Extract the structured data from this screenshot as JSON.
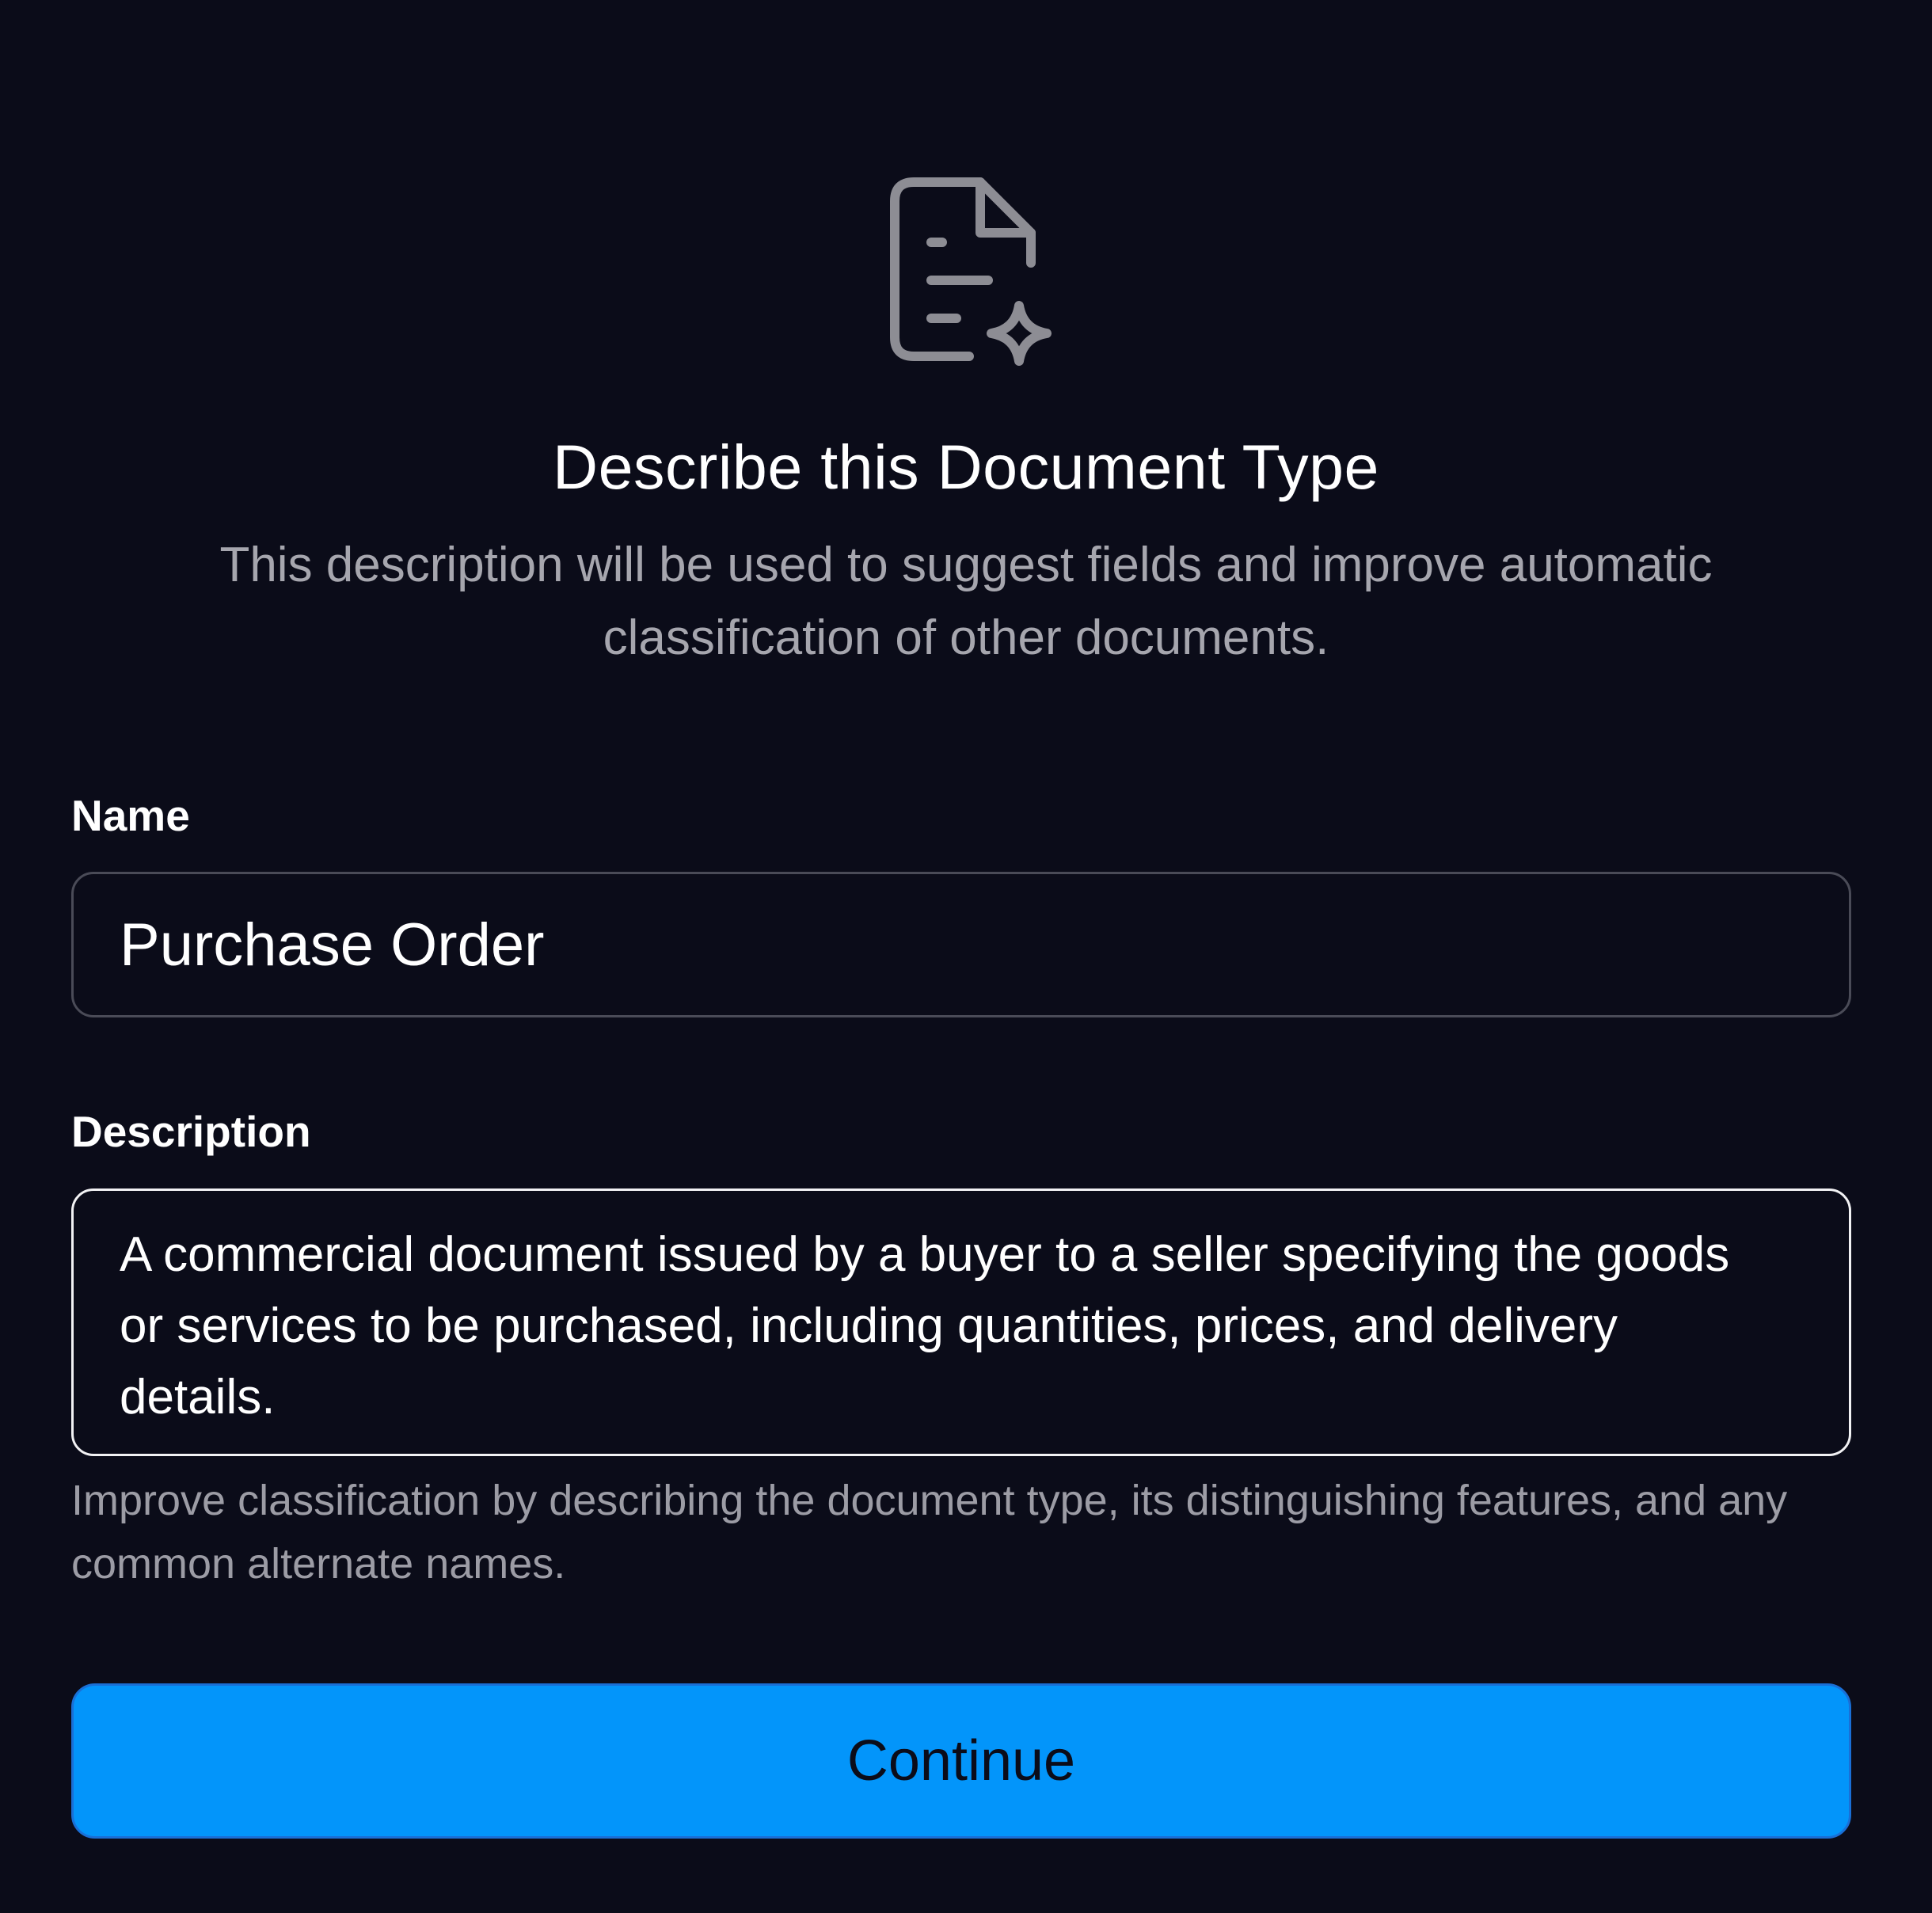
{
  "dialog": {
    "title": "Describe this Document Type",
    "subtitle": "This description will be used to suggest fields and improve automatic classification of other documents.",
    "icon": "document-sparkle-icon"
  },
  "form": {
    "name_label": "Name",
    "name_value": "Purchase Order",
    "description_label": "Description",
    "description_value": "A commercial document issued by a buyer to a seller specifying the goods or services to be purchased, including quantities, prices, and delivery details.",
    "description_helper": "Improve classification by describing the document type, its distinguishing features, and any common alternate names."
  },
  "actions": {
    "continue_label": "Continue"
  },
  "colors": {
    "background": "#0b0c19",
    "accent": "#0395fa",
    "muted_text": "#a6a6ae",
    "icon": "#8d8d94"
  }
}
